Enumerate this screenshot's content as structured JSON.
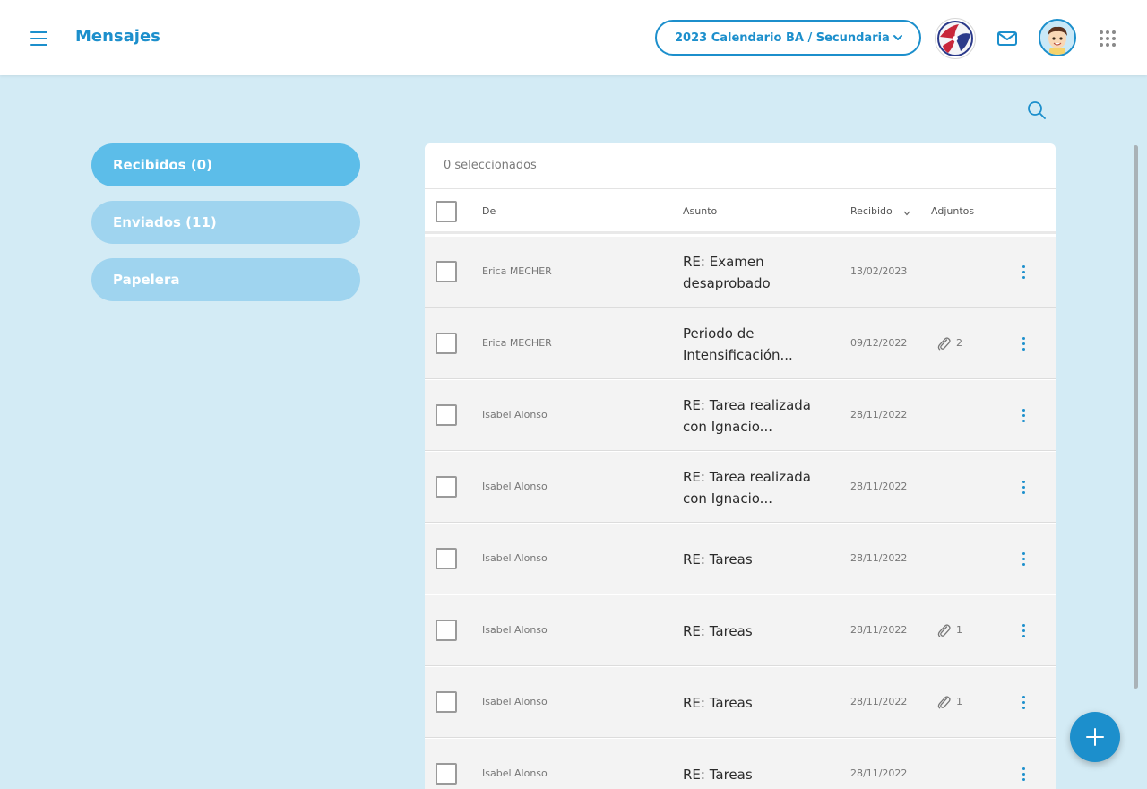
{
  "header": {
    "title": "Mensajes",
    "calendar_label": "2023 Calendario BA / Secundaria"
  },
  "folders": [
    {
      "label": "Recibidos (0)",
      "active": true
    },
    {
      "label": "Enviados (11)",
      "active": false
    },
    {
      "label": "Papelera",
      "active": false
    }
  ],
  "list": {
    "selected_count": "0 seleccionados",
    "columns": {
      "from": "De",
      "subject": "Asunto",
      "received": "Recibido",
      "attachments": "Adjuntos"
    },
    "rows": [
      {
        "from": "Erica MECHER",
        "subject": "RE: Examen desaprobado",
        "date": "13/02/2023",
        "attachments": ""
      },
      {
        "from": "Erica MECHER",
        "subject": "Periodo de Intensificación...",
        "date": "09/12/2022",
        "attachments": "2"
      },
      {
        "from": "Isabel Alonso",
        "subject": "RE: Tarea realizada con Ignacio...",
        "date": "28/11/2022",
        "attachments": ""
      },
      {
        "from": "Isabel Alonso",
        "subject": "RE: Tarea realizada con Ignacio...",
        "date": "28/11/2022",
        "attachments": ""
      },
      {
        "from": "Isabel Alonso",
        "subject": "RE: Tareas",
        "date": "28/11/2022",
        "attachments": ""
      },
      {
        "from": "Isabel Alonso",
        "subject": "RE: Tareas",
        "date": "28/11/2022",
        "attachments": "1"
      },
      {
        "from": "Isabel Alonso",
        "subject": "RE: Tareas",
        "date": "28/11/2022",
        "attachments": "1"
      },
      {
        "from": "Isabel Alonso",
        "subject": "RE: Tareas",
        "date": "28/11/2022",
        "attachments": ""
      }
    ]
  },
  "colors": {
    "accent": "#1c8fcc",
    "background": "#d3ebf5",
    "folder_active": "#5cbde9",
    "folder_inactive": "#9fd4ef"
  },
  "icons": {
    "menu": "hamburger-menu-icon",
    "dropdown": "chevron-down-icon",
    "mail": "mail-icon",
    "apps": "apps-grid-icon",
    "search": "search-icon",
    "attachment": "paperclip-icon",
    "row_menu": "more-vertical-icon",
    "compose": "plus-icon"
  }
}
